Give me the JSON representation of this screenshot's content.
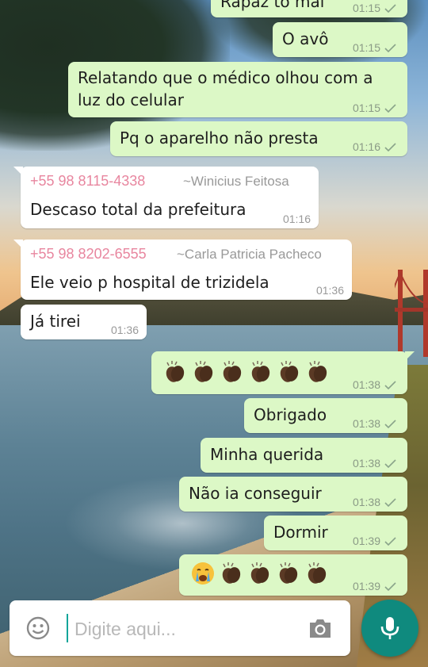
{
  "colors": {
    "outgoing_bubble": "#dcf8c6",
    "incoming_bubble": "#ffffff",
    "sender_number": "#e8869f",
    "accent": "#0f8a7e"
  },
  "messages": [
    {
      "id": "m0",
      "dir": "out",
      "text": "Rapaz tô mal",
      "time": "01:15",
      "status": "sent-check"
    },
    {
      "id": "m1",
      "dir": "out",
      "text": "O avô",
      "time": "01:15",
      "status": "sent-check"
    },
    {
      "id": "m2",
      "dir": "out",
      "text": "Relatando que o médico olhou com a\nluz do celular",
      "time": "01:15",
      "status": "sent-check"
    },
    {
      "id": "m3",
      "dir": "out",
      "text": "Pq o aparelho não presta",
      "time": "01:16",
      "status": "sent-check"
    },
    {
      "id": "m4",
      "dir": "in",
      "sender_number": "+55 98 8115-4338",
      "sender_name": "~Winicius Feitosa",
      "text": "Descaso total da prefeitura",
      "time": "01:16"
    },
    {
      "id": "m5",
      "dir": "in",
      "sender_number": "+55 98 8202-6555",
      "sender_name": "~Carla Patricia Pacheco",
      "text": "Ele veio p hospital de trizidela",
      "time": "01:36"
    },
    {
      "id": "m6",
      "dir": "in",
      "text": "Já tirei",
      "time": "01:36"
    },
    {
      "id": "m7",
      "dir": "out",
      "emoji": [
        "clapping-hands-icon",
        "clapping-hands-icon",
        "clapping-hands-icon",
        "clapping-hands-icon",
        "clapping-hands-icon",
        "clapping-hands-icon"
      ],
      "time": "01:38",
      "status": "sent-check"
    },
    {
      "id": "m8",
      "dir": "out",
      "text": "Obrigado",
      "time": "01:38",
      "status": "sent-check"
    },
    {
      "id": "m9",
      "dir": "out",
      "text": "Minha querida",
      "time": "01:38",
      "status": "sent-check"
    },
    {
      "id": "m10",
      "dir": "out",
      "text": "Não ia conseguir",
      "time": "01:38",
      "status": "sent-check"
    },
    {
      "id": "m11",
      "dir": "out",
      "text": "Dormir",
      "time": "01:39",
      "status": "sent-check"
    },
    {
      "id": "m12",
      "dir": "out",
      "emoji": [
        "crying-face-icon",
        "clapping-hands-icon",
        "clapping-hands-icon",
        "clapping-hands-icon",
        "clapping-hands-icon"
      ],
      "time": "01:39",
      "status": "sent-check"
    }
  ],
  "composer": {
    "placeholder": "Digite aqui...",
    "emoji_icon": "smiley-icon",
    "camera_icon": "camera-icon",
    "mic_icon": "microphone-icon"
  }
}
